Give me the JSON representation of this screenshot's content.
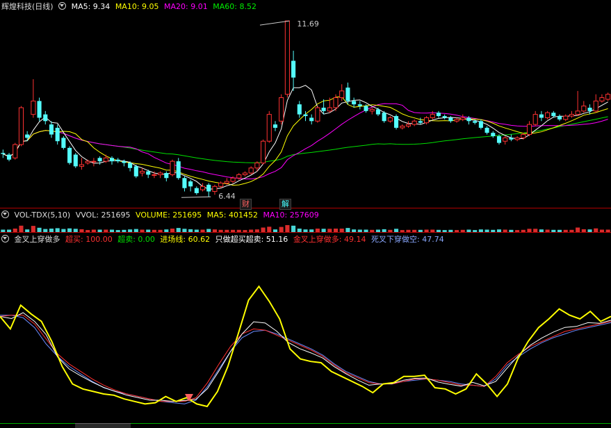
{
  "kline_header": {
    "title": "辉煌科技(日线)",
    "ma5": "MA5: 9.34",
    "ma10": "MA10: 9.05",
    "ma20": "MA20: 9.01",
    "ma60": "MA60: 8.52",
    "high_label": "11.69",
    "low_label": "6.44",
    "tag_cw": "财",
    "tag_jie": "解"
  },
  "vol_header": {
    "name": "VOL-TDX(5,10)",
    "vvol": "VVOL: 251695",
    "volume": "VOLUME: 251695",
    "ma5": "MA5: 401452",
    "ma10": "MA10: 257609"
  },
  "ind_header": {
    "name": "金叉上穿做多",
    "overbought": "超买: 100.00",
    "oversold": "超卖: 0.00",
    "entry": "进场线: 60.62",
    "only_ob_os": "只做超买超卖: 51.16",
    "golden": "金叉上穿做多: 49.14",
    "dead": "死叉下穿做空: 47.74"
  },
  "colors": {
    "up": "#ff3232",
    "down": "#54fcfc",
    "ma5": "#ffffff",
    "ma10": "#ffff00",
    "ma20": "#ff00ff",
    "ma60": "#00e000",
    "ind_yellow": "#ffff00",
    "ind_white": "#ffffff",
    "ind_red": "#ff3030",
    "ind_blue": "#6a8cff",
    "separator": "#b00000"
  },
  "chart_data": [
    {
      "type": "candlestick",
      "title": "辉煌科技(日线)",
      "price_range": [
        6.3,
        11.9
      ],
      "high": 11.69,
      "low": 6.44,
      "candles": [
        [
          7.75,
          7.72,
          7.6,
          7.85
        ],
        [
          7.7,
          7.55,
          7.5,
          7.75
        ],
        [
          7.6,
          8.0,
          7.55,
          8.05
        ],
        [
          8.0,
          9.1,
          7.95,
          9.15
        ],
        [
          8.3,
          8.2,
          8.1,
          8.4
        ],
        [
          8.9,
          9.3,
          8.8,
          9.95
        ],
        [
          9.3,
          8.8,
          8.7,
          9.4
        ],
        [
          8.9,
          8.7,
          8.6,
          9.0
        ],
        [
          8.6,
          8.3,
          8.2,
          8.7
        ],
        [
          8.5,
          8.1,
          8.0,
          8.6
        ],
        [
          8.2,
          7.9,
          7.85,
          8.25
        ],
        [
          7.9,
          7.45,
          7.4,
          7.95
        ],
        [
          7.7,
          7.35,
          7.3,
          7.75
        ],
        [
          7.35,
          7.4,
          7.25,
          7.6
        ],
        [
          7.45,
          7.5,
          7.4,
          7.55
        ],
        [
          7.5,
          7.5,
          7.35,
          7.6
        ],
        [
          7.6,
          7.5,
          7.4,
          7.65
        ],
        [
          7.5,
          7.6,
          7.45,
          7.7
        ],
        [
          7.6,
          7.5,
          7.4,
          7.65
        ],
        [
          7.55,
          7.5,
          7.45,
          7.6
        ],
        [
          7.5,
          7.45,
          7.35,
          7.55
        ],
        [
          7.45,
          7.3,
          7.2,
          7.5
        ],
        [
          7.35,
          7.05,
          7.0,
          7.4
        ],
        [
          7.15,
          7.2,
          7.05,
          7.3
        ],
        [
          7.2,
          7.1,
          7.0,
          7.25
        ],
        [
          7.1,
          7.1,
          7.0,
          7.2
        ],
        [
          7.1,
          7.15,
          7.0,
          7.2
        ],
        [
          7.15,
          7.0,
          6.9,
          7.2
        ],
        [
          7.1,
          7.5,
          7.05,
          7.55
        ],
        [
          7.5,
          7.0,
          6.95,
          7.6
        ],
        [
          7.0,
          6.7,
          6.6,
          7.05
        ],
        [
          6.9,
          6.75,
          6.6,
          6.95
        ],
        [
          6.7,
          6.55,
          6.5,
          6.75
        ],
        [
          6.65,
          6.75,
          6.6,
          6.85
        ],
        [
          6.8,
          6.6,
          6.44,
          6.85
        ],
        [
          6.6,
          6.75,
          6.5,
          6.8
        ],
        [
          6.75,
          6.85,
          6.7,
          6.9
        ],
        [
          6.85,
          6.9,
          6.8,
          7.0
        ],
        [
          6.9,
          7.0,
          6.85,
          7.05
        ],
        [
          7.0,
          7.1,
          6.95,
          7.15
        ],
        [
          7.1,
          7.15,
          7.05,
          7.2
        ],
        [
          7.15,
          7.3,
          7.1,
          7.35
        ],
        [
          7.3,
          7.45,
          7.2,
          7.5
        ],
        [
          7.45,
          8.1,
          7.4,
          8.15
        ],
        [
          8.1,
          8.9,
          8.05,
          9.0
        ],
        [
          8.6,
          8.5,
          8.4,
          8.7
        ],
        [
          8.7,
          9.4,
          8.6,
          9.5
        ],
        [
          9.5,
          11.69,
          9.4,
          11.69
        ],
        [
          10.5,
          10.0,
          9.6,
          10.8
        ],
        [
          9.2,
          8.9,
          8.8,
          9.3
        ],
        [
          8.9,
          8.85,
          8.7,
          9.0
        ],
        [
          8.8,
          8.7,
          8.6,
          8.9
        ],
        [
          8.7,
          9.1,
          8.65,
          9.15
        ],
        [
          9.1,
          9.0,
          8.9,
          9.35
        ],
        [
          9.0,
          9.1,
          8.95,
          9.4
        ],
        [
          9.1,
          9.4,
          9.0,
          9.5
        ],
        [
          9.4,
          9.6,
          9.3,
          9.8
        ],
        [
          9.7,
          9.3,
          9.2,
          9.85
        ],
        [
          9.3,
          9.2,
          9.1,
          9.4
        ],
        [
          9.2,
          9.15,
          9.05,
          9.3
        ],
        [
          9.15,
          9.0,
          8.95,
          9.2
        ],
        [
          9.0,
          9.05,
          8.9,
          9.1
        ],
        [
          9.05,
          8.9,
          8.85,
          9.1
        ],
        [
          8.95,
          8.7,
          8.65,
          9.0
        ],
        [
          8.7,
          8.8,
          8.65,
          8.85
        ],
        [
          8.85,
          8.5,
          8.45,
          8.9
        ],
        [
          8.5,
          8.55,
          8.45,
          8.6
        ],
        [
          8.55,
          8.6,
          8.5,
          8.7
        ],
        [
          8.6,
          8.7,
          8.55,
          8.75
        ],
        [
          8.7,
          8.65,
          8.6,
          8.8
        ],
        [
          8.65,
          8.8,
          8.6,
          8.85
        ],
        [
          8.8,
          8.9,
          8.75,
          9.0
        ],
        [
          8.95,
          8.85,
          8.8,
          9.0
        ],
        [
          8.85,
          8.8,
          8.75,
          8.9
        ],
        [
          8.8,
          8.7,
          8.65,
          8.85
        ],
        [
          8.7,
          8.75,
          8.65,
          8.8
        ],
        [
          8.75,
          8.8,
          8.7,
          8.9
        ],
        [
          8.8,
          8.7,
          8.6,
          8.85
        ],
        [
          8.7,
          8.65,
          8.6,
          8.75
        ],
        [
          8.7,
          8.5,
          8.45,
          8.75
        ],
        [
          8.5,
          8.35,
          8.3,
          8.55
        ],
        [
          8.35,
          8.25,
          8.2,
          8.4
        ],
        [
          8.25,
          8.05,
          8.0,
          8.3
        ],
        [
          8.1,
          8.2,
          8.0,
          8.25
        ],
        [
          8.2,
          8.15,
          8.1,
          8.3
        ],
        [
          8.15,
          8.2,
          8.1,
          8.25
        ],
        [
          8.2,
          8.3,
          8.15,
          8.35
        ],
        [
          8.3,
          8.6,
          8.25,
          8.7
        ],
        [
          8.6,
          8.9,
          8.55,
          9.0
        ],
        [
          8.9,
          8.8,
          8.7,
          9.0
        ],
        [
          8.8,
          8.95,
          8.75,
          9.0
        ],
        [
          8.95,
          8.85,
          8.8,
          9.0
        ],
        [
          8.85,
          8.75,
          8.7,
          8.9
        ],
        [
          8.75,
          8.85,
          8.7,
          8.9
        ],
        [
          8.85,
          8.9,
          8.8,
          9.0
        ],
        [
          8.9,
          9.0,
          8.85,
          9.6
        ],
        [
          9.0,
          9.15,
          8.95,
          9.3
        ],
        [
          9.1,
          9.0,
          8.9,
          9.2
        ],
        [
          9.0,
          9.3,
          8.95,
          9.5
        ],
        [
          9.3,
          9.4,
          9.25,
          9.5
        ],
        [
          9.35,
          9.5,
          9.3,
          9.55
        ]
      ]
    },
    {
      "type": "line",
      "title": "金叉上穿做多",
      "ylim": [
        0,
        100
      ],
      "series": [
        {
          "name": "进场线",
          "color": "#ffff00",
          "values": [
            72,
            62,
            81,
            74,
            68,
            52,
            32,
            18,
            14,
            12,
            10,
            9,
            6,
            4,
            2,
            3,
            8,
            4,
            7,
            2,
            0,
            12,
            32,
            58,
            85,
            96,
            84,
            70,
            46,
            38,
            36,
            35,
            28,
            24,
            20,
            16,
            11,
            18,
            19,
            24,
            24,
            25,
            15,
            14,
            10,
            14,
            26,
            18,
            8,
            18,
            38,
            52,
            63,
            70,
            78,
            73,
            70,
            76,
            68,
            72
          ]
        },
        {
          "name": "金叉上穿做多",
          "color": "#ff3030",
          "values": [
            72,
            73,
            73,
            66,
            54,
            42,
            34,
            28,
            22,
            17,
            13,
            10,
            8,
            6,
            4,
            4,
            4,
            7,
            19,
            34,
            48,
            58,
            62,
            61,
            57,
            53,
            49,
            45,
            40,
            33,
            27,
            23,
            19,
            18,
            18,
            20,
            22,
            22,
            21,
            19,
            17,
            17,
            16,
            24,
            35,
            42,
            48,
            52,
            56,
            60,
            62,
            64,
            66,
            68
          ]
        },
        {
          "name": "死叉下穿做空",
          "color": "#6a8cff",
          "values": [
            73,
            73,
            71,
            63,
            50,
            40,
            32,
            26,
            20,
            15,
            12,
            10,
            8,
            6,
            4,
            3,
            2,
            5,
            16,
            30,
            44,
            55,
            60,
            61,
            58,
            54,
            50,
            46,
            41,
            34,
            28,
            24,
            20,
            18,
            18,
            20,
            21,
            22,
            21,
            20,
            18,
            17,
            16,
            22,
            33,
            40,
            46,
            51,
            55,
            58,
            61,
            63,
            65,
            67
          ]
        }
      ]
    }
  ]
}
